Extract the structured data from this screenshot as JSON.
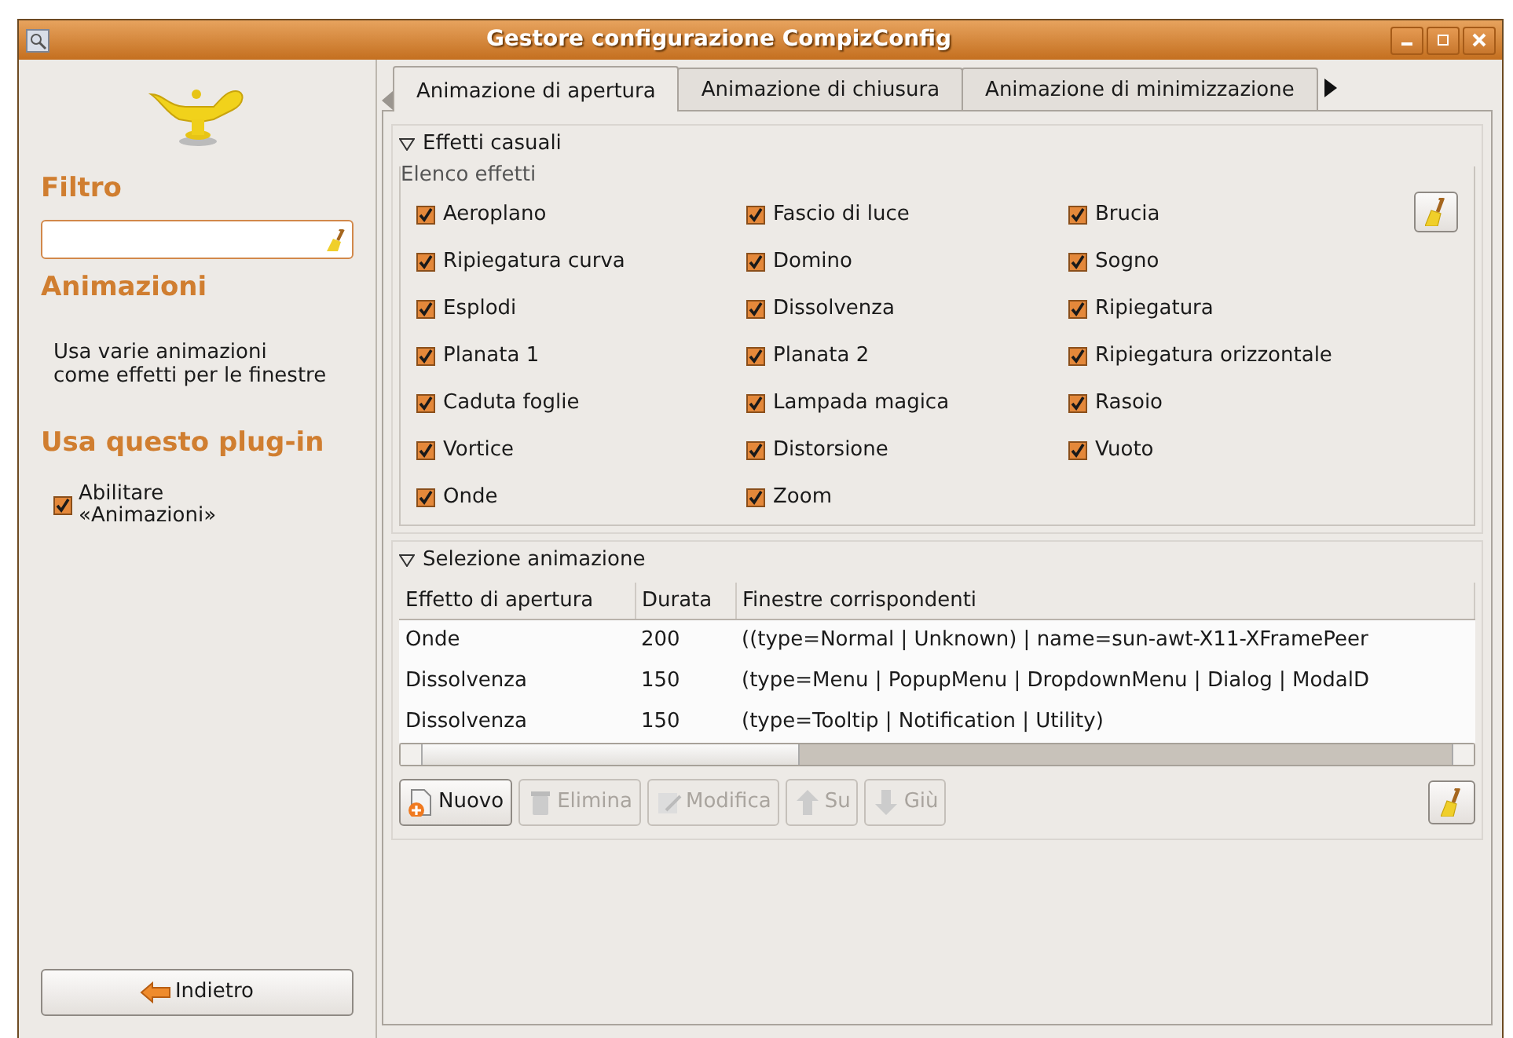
{
  "window": {
    "title": "Gestore configurazione CompizConfig"
  },
  "sidebar": {
    "filter_heading": "Filtro",
    "plugin_title": "Animazioni",
    "plugin_description": "Usa varie animazioni come effetti per le finestre",
    "enable_heading": "Usa questo plug-in",
    "enable_checkbox": {
      "label": "Abilitare «Animazioni»",
      "checked": true
    },
    "back_button": "Indietro"
  },
  "tabs": [
    {
      "label": "Animazione di apertura",
      "selected": true
    },
    {
      "label": "Animazione di chiusura",
      "selected": false
    },
    {
      "label": "Animazione di minimizzazione",
      "selected": false
    }
  ],
  "random_effects": {
    "title": "Effetti casuali",
    "expanded": true,
    "group_label": "Elenco effetti",
    "effects": [
      {
        "label": "Aeroplano",
        "checked": true
      },
      {
        "label": "Fascio di luce",
        "checked": true
      },
      {
        "label": "Brucia",
        "checked": true
      },
      {
        "label": "Ripiegatura curva",
        "checked": true
      },
      {
        "label": "Domino",
        "checked": true
      },
      {
        "label": "Sogno",
        "checked": true
      },
      {
        "label": "Esplodi",
        "checked": true
      },
      {
        "label": "Dissolvenza",
        "checked": true
      },
      {
        "label": "Ripiegatura",
        "checked": true
      },
      {
        "label": "Planata 1",
        "checked": true
      },
      {
        "label": "Planata 2",
        "checked": true
      },
      {
        "label": "Ripiegatura orizzontale",
        "checked": true
      },
      {
        "label": "Caduta foglie",
        "checked": true
      },
      {
        "label": "Lampada magica",
        "checked": true
      },
      {
        "label": "Rasoio",
        "checked": true
      },
      {
        "label": "Vortice",
        "checked": true
      },
      {
        "label": "Distorsione",
        "checked": true
      },
      {
        "label": "Vuoto",
        "checked": true
      },
      {
        "label": "Onde",
        "checked": true
      },
      {
        "label": "Zoom",
        "checked": true
      }
    ]
  },
  "animation_selection": {
    "title": "Selezione animazione",
    "expanded": true,
    "table": {
      "columns": [
        "Effetto di apertura",
        "Durata",
        "Finestre corrispondenti"
      ],
      "rows": [
        [
          "Onde",
          "200",
          "((type=Normal | Unknown) | name=sun-awt-X11-XFramePeer"
        ],
        [
          "Dissolvenza",
          "150",
          "(type=Menu | PopupMenu | DropdownMenu | Dialog | ModalD"
        ],
        [
          "Dissolvenza",
          "150",
          "(type=Tooltip | Notification | Utility)"
        ]
      ]
    },
    "buttons": [
      {
        "label": "Nuovo",
        "kind": "new",
        "disabled": false
      },
      {
        "label": "Elimina",
        "kind": "delete",
        "disabled": true
      },
      {
        "label": "Modifica",
        "kind": "edit",
        "disabled": true
      },
      {
        "label": "Su",
        "kind": "up",
        "disabled": true
      },
      {
        "label": "Giù",
        "kind": "down",
        "disabled": true
      }
    ]
  }
}
